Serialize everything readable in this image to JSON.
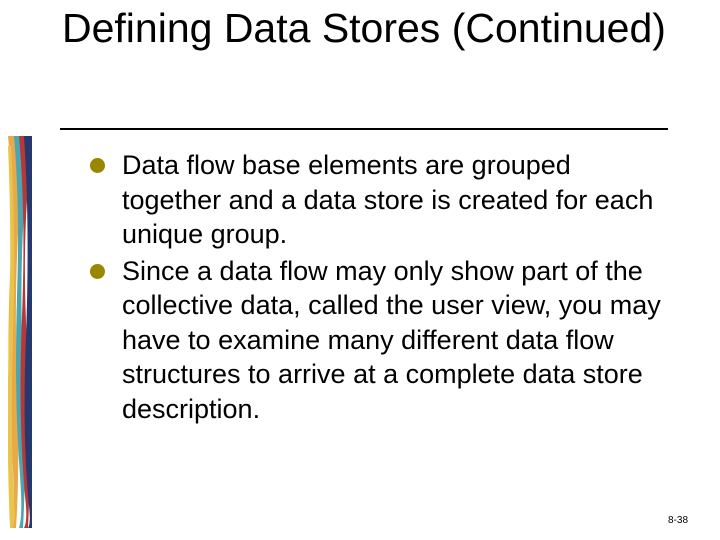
{
  "title": "Defining Data Stores (Continued)",
  "bullets": [
    "Data flow base elements are grouped together and a data store is created for each unique group.",
    "Since a data flow may only show part of the collective data, called the user view, you may have to examine many different data flow structures to arrive at a complete data store description."
  ],
  "page_number": "8-38",
  "bullet_color": "#9b8600",
  "deco_colors": [
    "#e8a94a",
    "#4aa6b0",
    "#b63838",
    "#26396f",
    "#e8c44a"
  ]
}
